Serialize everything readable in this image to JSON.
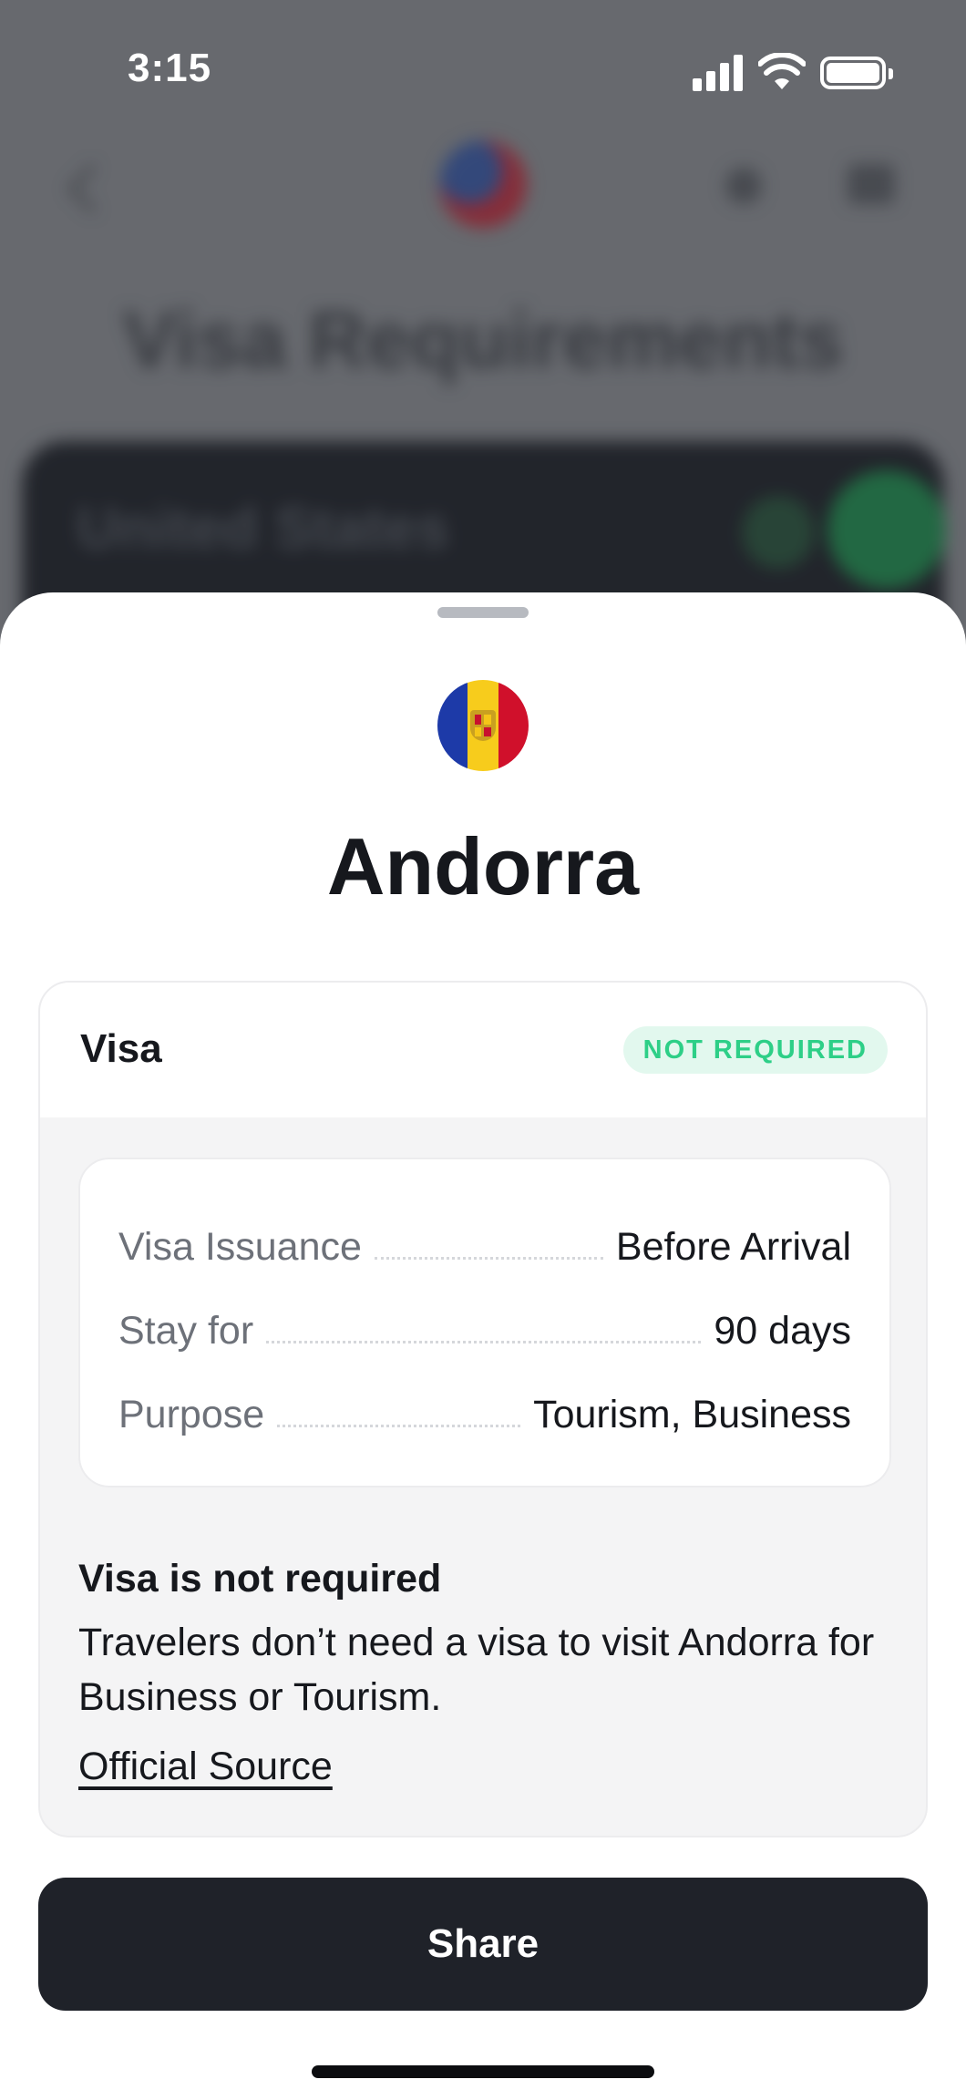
{
  "status_bar": {
    "time": "3:15"
  },
  "background": {
    "page_title": "Visa Requirements",
    "passport_country": "United States"
  },
  "sheet": {
    "country": "Andorra",
    "visa": {
      "label": "Visa",
      "status": "NOT REQUIRED",
      "status_color": "#2dcf87",
      "details": [
        {
          "key": "Visa Issuance",
          "value": "Before Arrival"
        },
        {
          "key": "Stay for",
          "value": "90 days"
        },
        {
          "key": "Purpose",
          "value": "Tourism, Business"
        }
      ],
      "note_title": "Visa is not required",
      "note_text": "Travelers don’t need a visa to visit Andorra for Business or Tourism.",
      "official_source_label": "Official Source"
    },
    "share_label": "Share"
  },
  "colors": {
    "primary_dark": "#1f2229",
    "accent_green": "#2dcf87"
  },
  "icons": {
    "flag": "andorra-flag-icon",
    "back": "chevron-left-icon",
    "signal": "cellular-signal-icon",
    "wifi": "wifi-icon",
    "battery": "battery-icon"
  }
}
